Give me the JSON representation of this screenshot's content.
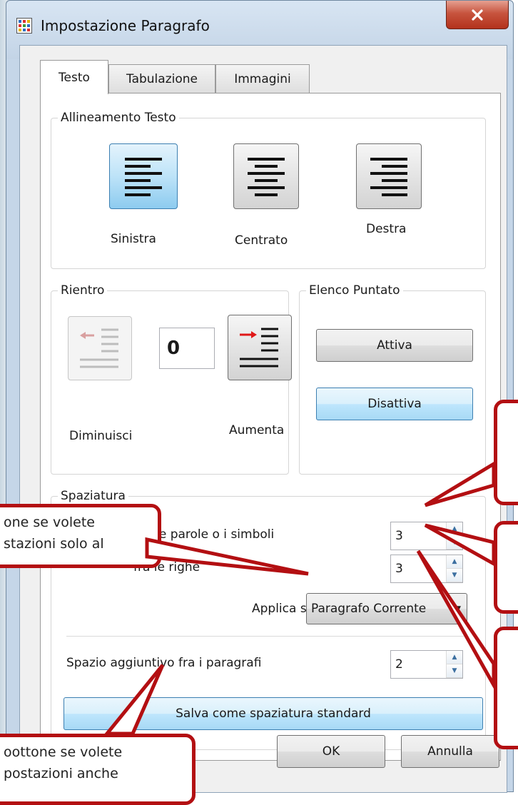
{
  "window": {
    "title": "Impostazione Paragrafo",
    "close_glyph": "x"
  },
  "tabs": [
    {
      "label": "Testo",
      "active": true
    },
    {
      "label": "Tabulazione",
      "active": false
    },
    {
      "label": "Immagini",
      "active": false
    }
  ],
  "alignment": {
    "legend": "Allineamento Testo",
    "left_label": "Sinistra",
    "center_label": "Centrato",
    "right_label": "Destra",
    "selected": "left"
  },
  "indent": {
    "legend": "Rientro",
    "value": "0",
    "decrease_label": "Diminuisci",
    "increase_label": "Aumenta"
  },
  "bullets": {
    "legend": "Elenco Puntato",
    "activate_label": "Attiva",
    "deactivate_label": "Disattiva"
  },
  "spacing": {
    "legend": "Spaziatura",
    "words_label": "Spaziatura fra le parole o i simboli",
    "words_value": "3",
    "lines_label": "fra le righe",
    "lines_value": "3",
    "apply_label": "Applica su",
    "apply_value": "Paragrafo Corrente",
    "paragraph_label": "Spazio aggiuntivo fra i paragrafi",
    "paragraph_value": "2",
    "save_label": "Salva come spaziatura standard"
  },
  "footer": {
    "ok_label": "OK",
    "cancel_label": "Annulla"
  },
  "callouts": {
    "apply_line1": "one se volete",
    "apply_line2": "stazioni solo al",
    "save_line1": "oottone se volete",
    "save_line2": "postazioni anche"
  },
  "colors": {
    "callout_border": "#b30f12",
    "selected_blue": "#8dcbef"
  }
}
